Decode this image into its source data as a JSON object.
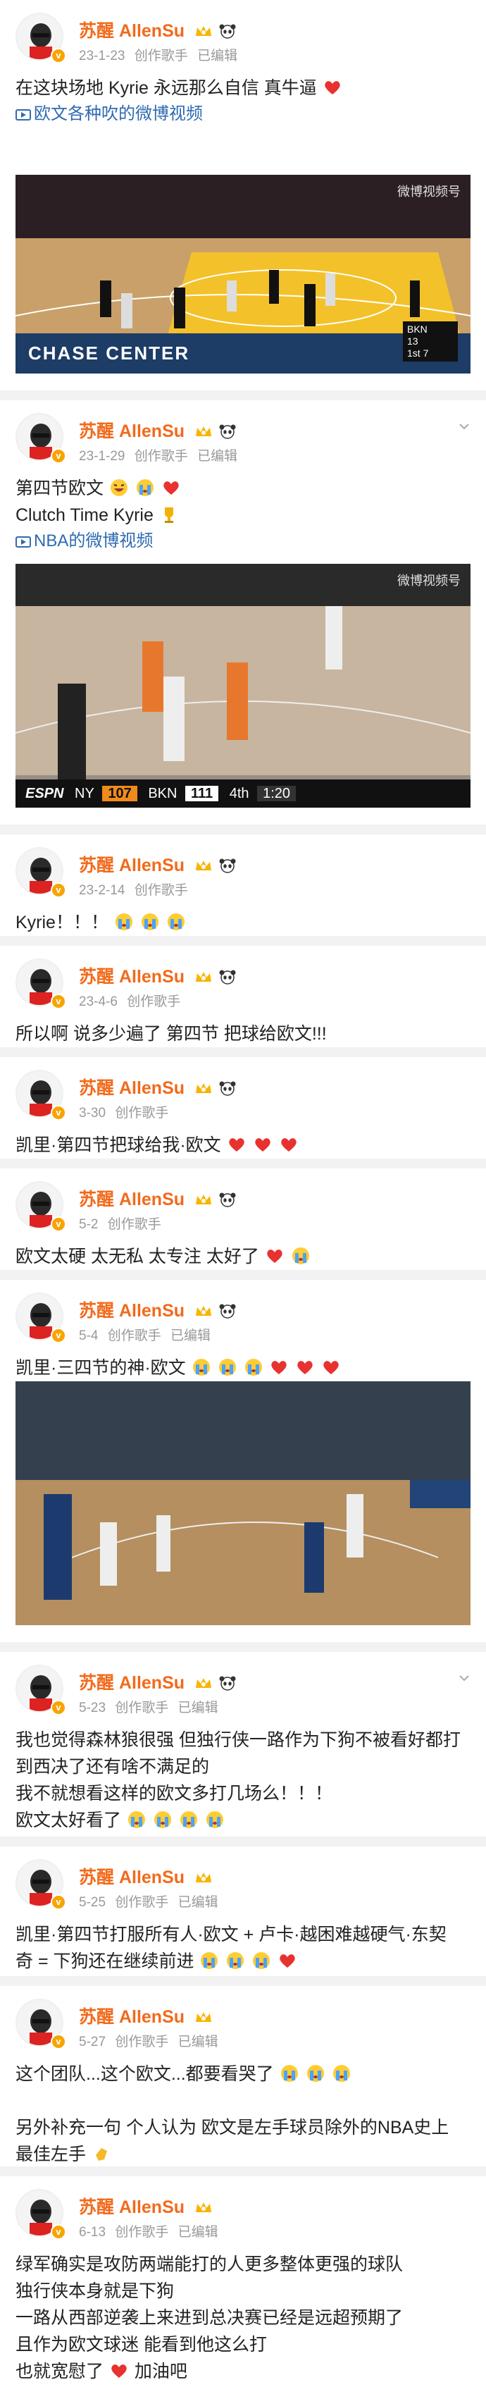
{
  "user": {
    "name": "苏醒 AllenSu"
  },
  "posts": [
    {
      "time": "23-1-23",
      "source": "创作歌手",
      "edited": "已编辑",
      "lines": [
        "在这块场地 Kyrie 永远那么自信 真牛逼"
      ],
      "emojis": [
        "heart"
      ],
      "link": "欧文各种吹的微博视频",
      "scoreboard": {
        "team": "BKN",
        "score": "13",
        "period": "1st",
        "clock": "7"
      }
    },
    {
      "time": "23-1-29",
      "source": "创作歌手",
      "edited": "已编辑",
      "lines": [
        "第四节欧文",
        "Clutch Time Kyrie"
      ],
      "link": "NBA的微博视频",
      "scoreboard": {
        "network": "ESPN",
        "home": "NY",
        "home_score": "107",
        "away": "BKN",
        "away_score": "111",
        "period": "4th",
        "clock": "1:20"
      }
    },
    {
      "time": "23-2-14",
      "source": "创作歌手",
      "lines": [
        "Kyrie！！！"
      ]
    },
    {
      "time": "23-4-6",
      "source": "创作歌手",
      "lines": [
        "所以啊 说多少遍了 第四节 把球给欧文!!!"
      ]
    },
    {
      "time": "3-30",
      "source": "创作歌手",
      "lines": [
        "凯里·第四节把球给我·欧文"
      ]
    },
    {
      "time": "5-2",
      "source": "创作歌手",
      "lines": [
        "欧文太硬 太无私 太专注 太好了"
      ]
    },
    {
      "time": "5-4",
      "source": "创作歌手",
      "edited": "已编辑",
      "lines": [
        "凯里·三四节的神·欧文"
      ]
    },
    {
      "time": "5-23",
      "source": "创作歌手",
      "edited": "已编辑",
      "lines": [
        "我也觉得森林狼很强 但独行侠一路作为下狗不被看好都打",
        "到西决了还有啥不满足的",
        "我不就想看这样的欧文多打几场么！！！",
        "欧文太好看了"
      ]
    },
    {
      "time": "5-25",
      "source": "创作歌手",
      "edited": "已编辑",
      "lines": [
        "凯里·第四节打服所有人·欧文 + 卢卡·越困难越硬气·东契",
        "奇 = 下狗还在继续前进"
      ]
    },
    {
      "time": "5-27",
      "source": "创作歌手",
      "edited": "已编辑",
      "lines": [
        "这个团队...这个欧文...都要看哭了",
        "另外补充一句 个人认为 欧文是左手球员除外的NBA史上",
        "最佳左手"
      ]
    },
    {
      "time": "6-13",
      "source": "创作歌手",
      "edited": "已编辑",
      "lines": [
        "绿军确实是攻防两端能打的人更多整体更强的球队",
        "独行侠本身就是下狗",
        "一路从西部逆袭上来进到总决赛已经是远超预期了",
        "且作为欧文球迷 能看到他这么打",
        "也就宽慰了",
        "加油吧"
      ]
    }
  ],
  "watermark": "微博视频号",
  "ad_text": "CHASE CENTER",
  "colors": {
    "name": "#f26a1b",
    "link": "#2e6ab1",
    "meta": "#999999",
    "heart": "#e8322f"
  }
}
